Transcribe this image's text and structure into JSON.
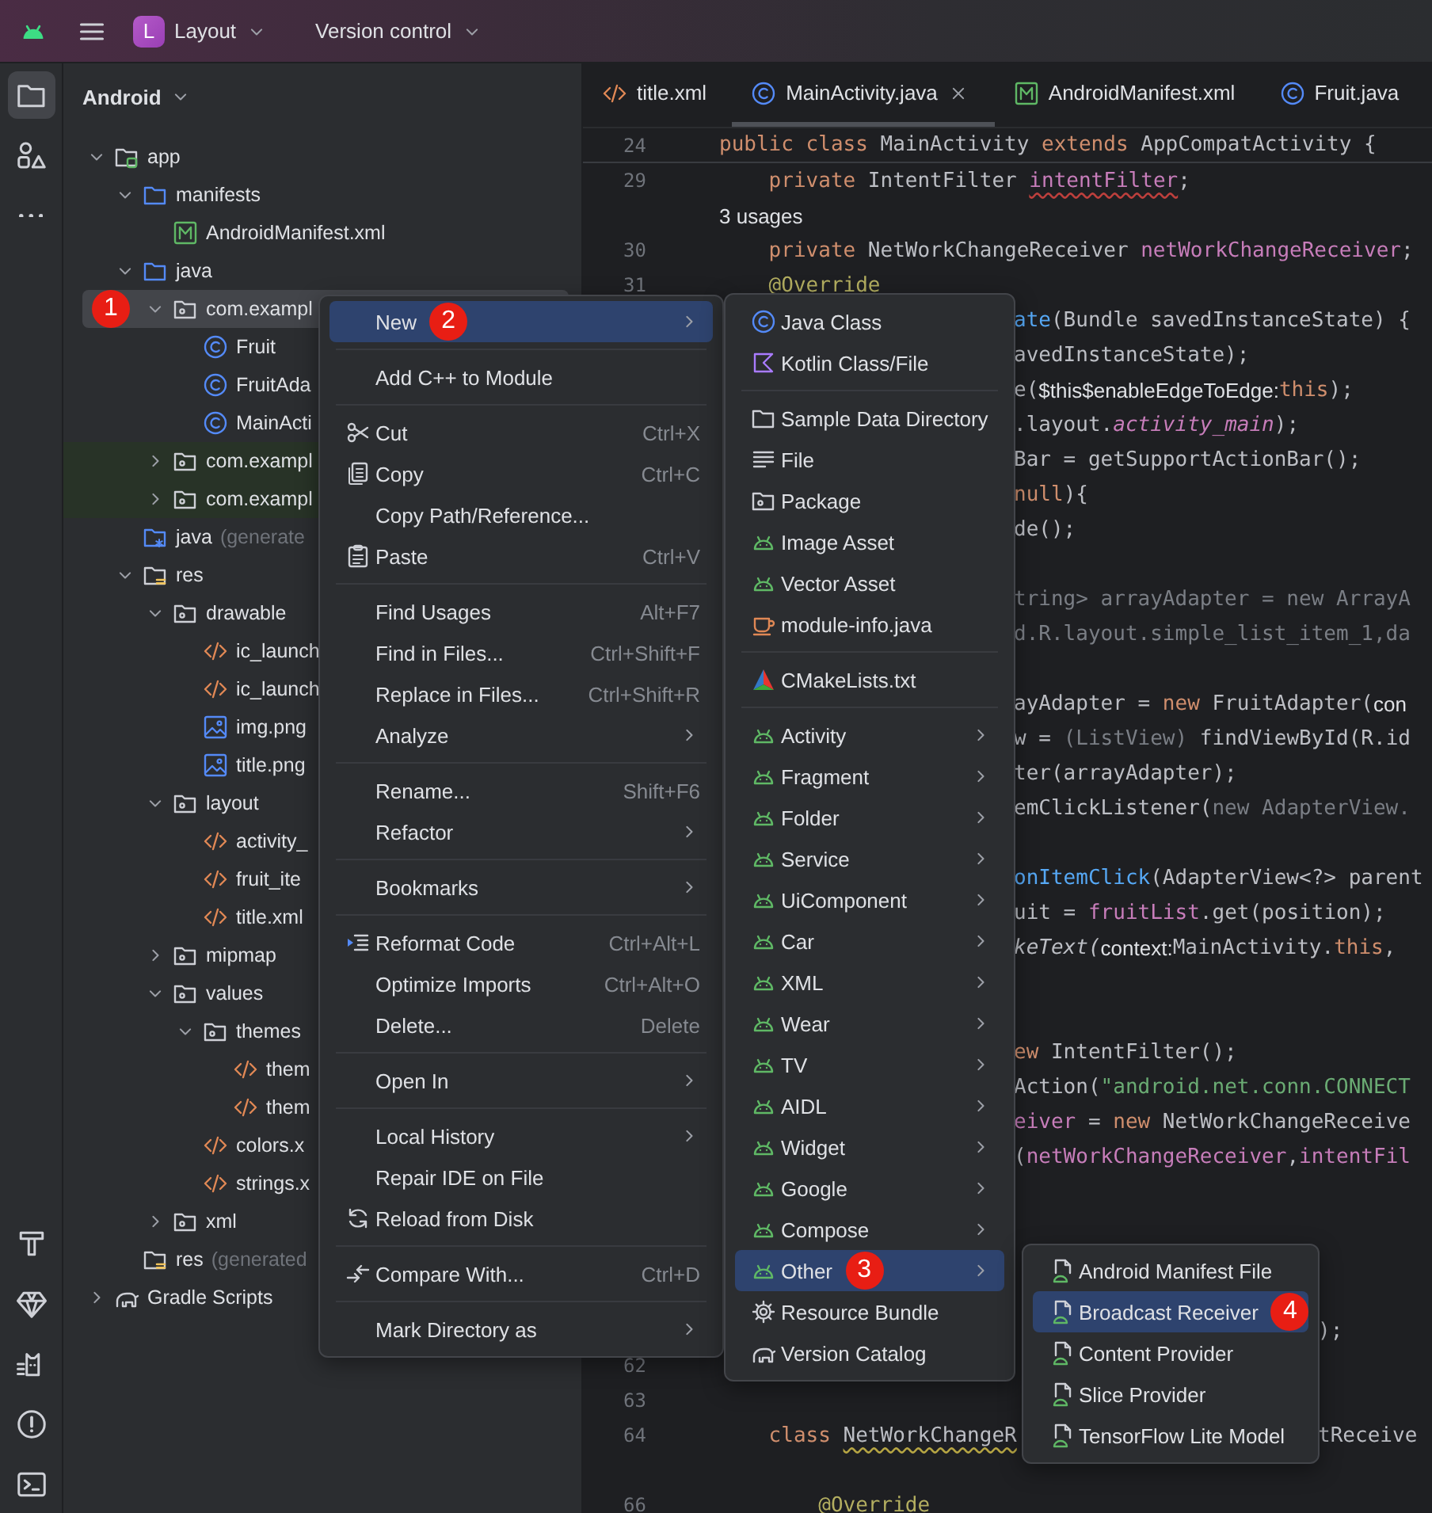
{
  "title_bar": {
    "project_badge": "L",
    "project_name": "Layout",
    "vcs_label": "Version control"
  },
  "toolbar_top": [
    {
      "kind": "folder",
      "selected": true
    },
    {
      "kind": "shapes",
      "selected": false
    },
    {
      "kind": "more",
      "selected": false
    }
  ],
  "toolbar_bottom": [
    {
      "kind": "hammer"
    },
    {
      "kind": "gem"
    },
    {
      "kind": "cat"
    },
    {
      "kind": "alert"
    },
    {
      "kind": "terminal"
    }
  ],
  "project_panel": {
    "view": "Android",
    "items": [
      {
        "label": "app",
        "kind": "module",
        "expanded": true,
        "selected": false,
        "children": [
          {
            "label": "manifests",
            "kind": "folder-blue",
            "expanded": true,
            "selected": false,
            "children": [
              {
                "label": "AndroidManifest.xml",
                "kind": "manifest",
                "selected": false
              }
            ]
          },
          {
            "label": "java",
            "kind": "folder-blue",
            "expanded": true,
            "selected": false,
            "children": [
              {
                "label": "com.exampl",
                "kind": "package",
                "expanded": true,
                "selected": true,
                "badge": "1",
                "children": [
                  {
                    "label": "Fruit",
                    "kind": "class",
                    "selected": false
                  },
                  {
                    "label": "FruitAda",
                    "kind": "class",
                    "selected": false
                  },
                  {
                    "label": "MainActi",
                    "kind": "class",
                    "selected": false
                  }
                ]
              },
              {
                "label": "com.exampl",
                "kind": "test-package",
                "expanded": false,
                "selected": false
              },
              {
                "label": "com.exampl",
                "kind": "test-package",
                "expanded": false,
                "selected": false
              }
            ]
          },
          {
            "label": "java",
            "note": "(generate",
            "kind": "java-gen",
            "selected": false
          },
          {
            "label": "res",
            "kind": "res",
            "expanded": true,
            "selected": false,
            "children": [
              {
                "label": "drawable",
                "kind": "package",
                "expanded": true,
                "selected": false,
                "children": [
                  {
                    "label": "ic_launch",
                    "kind": "xml",
                    "selected": false
                  },
                  {
                    "label": "ic_launch",
                    "kind": "xml",
                    "selected": false
                  },
                  {
                    "label": "img.png",
                    "kind": "image",
                    "selected": false
                  },
                  {
                    "label": "title.png",
                    "kind": "image",
                    "selected": false
                  }
                ]
              },
              {
                "label": "layout",
                "kind": "package",
                "expanded": true,
                "selected": false,
                "children": [
                  {
                    "label": "activity_",
                    "kind": "xml",
                    "selected": false
                  },
                  {
                    "label": "fruit_ite",
                    "kind": "xml",
                    "selected": false
                  },
                  {
                    "label": "title.xml",
                    "kind": "xml",
                    "selected": false
                  }
                ]
              },
              {
                "label": "mipmap",
                "kind": "package",
                "expanded": false,
                "selected": false
              },
              {
                "label": "values",
                "kind": "package",
                "expanded": true,
                "selected": false,
                "children": [
                  {
                    "label": "themes",
                    "kind": "package",
                    "expanded": true,
                    "selected": false,
                    "children": [
                      {
                        "label": "them",
                        "kind": "xml",
                        "selected": false
                      },
                      {
                        "label": "them",
                        "kind": "xml",
                        "selected": false
                      }
                    ]
                  },
                  {
                    "label": "colors.x",
                    "kind": "xml",
                    "selected": false
                  },
                  {
                    "label": "strings.x",
                    "kind": "xml",
                    "selected": false
                  }
                ]
              },
              {
                "label": "xml",
                "kind": "package",
                "expanded": false,
                "selected": false
              }
            ]
          },
          {
            "label": "res",
            "note": "(generated",
            "kind": "res",
            "selected": false
          }
        ]
      },
      {
        "label": "Gradle Scripts",
        "kind": "gradle",
        "expanded": false,
        "selected": false
      }
    ]
  },
  "editor": {
    "tabs": [
      {
        "label": "title.xml",
        "kind": "xml",
        "selected": false
      },
      {
        "label": "MainActivity.java",
        "kind": "class",
        "selected": true
      },
      {
        "label": "AndroidManifest.xml",
        "kind": "manifest",
        "selected": false
      },
      {
        "label": "Fruit.java",
        "kind": "class",
        "selected": false
      }
    ],
    "sticky_line": {
      "number": "24",
      "tokens": [
        {
          "text": "public class ",
          "kind": "keyword"
        },
        {
          "text": "MainActivity ",
          "kind": "plain"
        },
        {
          "text": "extends ",
          "kind": "keyword"
        },
        {
          "text": "AppCompatActivity {",
          "kind": "plain"
        }
      ]
    },
    "rows": [
      {
        "number": "29",
        "parts": [
          [
            {
              "text": "    private ",
              "kind": "keyword"
            },
            {
              "text": "IntentFilter ",
              "kind": "plain"
            },
            {
              "text": "intentFilter",
              "kind": "field-warning"
            },
            {
              "text": ";",
              "kind": "plain"
            }
          ]
        ]
      },
      {
        "parts": [
          [
            {
              "text": "3 usages",
              "kind": "usages"
            }
          ]
        ]
      },
      {
        "number": "30",
        "parts": [
          [
            {
              "text": "    private ",
              "kind": "keyword"
            },
            {
              "text": "NetWorkChangeReceiver ",
              "kind": "plain"
            },
            {
              "text": "netWorkChangeReceiver",
              "kind": "field"
            },
            {
              "text": ";",
              "kind": "plain"
            }
          ]
        ]
      },
      {
        "number": "31",
        "parts": [
          [
            {
              "text": "    @Override",
              "kind": "annotation"
            }
          ]
        ]
      },
      {
        "parts": [
          [
            {
              "text": "ate",
              "kind": "method"
            },
            {
              "text": "(Bundle savedInstanceState) {",
              "kind": "plain"
            }
          ]
        ]
      },
      {
        "parts": [
          [
            {
              "text": "avedInstanceState);",
              "kind": "plain"
            }
          ]
        ]
      },
      {
        "parts": [
          [
            {
              "text": "e(",
              "kind": "plain"
            },
            {
              "text": "$this$enableEdgeToEdge:",
              "kind": "hint"
            },
            {
              "text": "this",
              "kind": "keyword"
            },
            {
              "text": ");",
              "kind": "plain"
            }
          ]
        ]
      },
      {
        "parts": [
          [
            {
              "text": ".layout.",
              "kind": "plain"
            },
            {
              "text": "activity_main",
              "kind": "field-italic"
            },
            {
              "text": ");",
              "kind": "plain"
            }
          ]
        ]
      },
      {
        "parts": [
          [
            {
              "text": "Bar = getSupportActionBar();",
              "kind": "plain"
            }
          ]
        ]
      },
      {
        "parts": [
          [
            {
              "text": "null",
              "kind": "keyword"
            },
            {
              "text": "){",
              "kind": "plain"
            }
          ]
        ]
      },
      {
        "parts": [
          [
            {
              "text": "de();",
              "kind": "plain"
            }
          ]
        ]
      },
      {},
      {
        "parts": [
          [
            {
              "text": "tring> arrayAdapter = new ArrayA",
              "kind": "dim"
            }
          ]
        ]
      },
      {
        "parts": [
          [
            {
              "text": "d.R.layout.simple_list_item_1,da",
              "kind": "dim"
            }
          ]
        ]
      },
      {},
      {
        "parts": [
          [
            {
              "text": "ayAdapter = ",
              "kind": "plain"
            },
            {
              "text": "new",
              "kind": "keyword"
            },
            {
              "text": " FruitAdapter(",
              "kind": "plain"
            },
            {
              "text": "con",
              "kind": "hint"
            }
          ]
        ]
      },
      {
        "parts": [
          [
            {
              "text": "w = ",
              "kind": "plain"
            },
            {
              "text": "(ListView)",
              "kind": "dim"
            },
            {
              "text": " findViewById(R.id",
              "kind": "plain"
            }
          ]
        ]
      },
      {
        "parts": [
          [
            {
              "text": "ter(arrayAdapter);",
              "kind": "plain"
            }
          ]
        ]
      },
      {
        "parts": [
          [
            {
              "text": "emClickListener(",
              "kind": "plain"
            },
            {
              "text": "new AdapterView.",
              "kind": "dim"
            }
          ]
        ]
      },
      {},
      {
        "parts": [
          [
            {
              "text": "onItemClick",
              "kind": "method"
            },
            {
              "text": "(AdapterView<?> parent",
              "kind": "plain"
            }
          ]
        ]
      },
      {
        "parts": [
          [
            {
              "text": "uit = ",
              "kind": "plain"
            },
            {
              "text": "fruitList",
              "kind": "field"
            },
            {
              "text": ".get(position);",
              "kind": "plain"
            }
          ]
        ]
      },
      {
        "parts": [
          [
            {
              "text": "keText(",
              "kind": "italic"
            },
            {
              "text": "context:",
              "kind": "hint"
            },
            {
              "text": "MainActivity.",
              "kind": "plain"
            },
            {
              "text": "this",
              "kind": "keyword"
            },
            {
              "text": ",",
              "kind": "plain"
            }
          ]
        ]
      },
      {},
      {},
      {
        "parts": [
          [
            {
              "text": "ew",
              "kind": "keyword"
            },
            {
              "text": " IntentFilter();",
              "kind": "plain"
            }
          ]
        ]
      },
      {
        "parts": [
          [
            {
              "text": "Action(",
              "kind": "plain"
            },
            {
              "text": "\"android.net.conn.CONNECT",
              "kind": "string"
            }
          ]
        ]
      },
      {
        "parts": [
          [
            {
              "text": "eiver",
              "kind": "field"
            },
            {
              "text": " = ",
              "kind": "plain"
            },
            {
              "text": "new",
              "kind": "keyword"
            },
            {
              "text": " NetWorkChangeReceive",
              "kind": "plain"
            }
          ]
        ]
      },
      {
        "parts": [
          [
            {
              "text": "(",
              "kind": "plain"
            },
            {
              "text": "netWorkChangeReceiver",
              "kind": "field"
            },
            {
              "text": ",",
              "kind": "plain"
            },
            {
              "text": "intentFil",
              "kind": "field"
            }
          ]
        ]
      },
      {},
      {},
      {},
      {},
      {
        "parts": [
          [
            {
              "text": ");",
              "kind": "plain"
            }
          ]
        ]
      },
      {
        "number": "62"
      },
      {
        "number": "63"
      },
      {
        "number": "64",
        "parts": [
          [
            {
              "text": "    class ",
              "kind": "keyword"
            },
            {
              "text": "NetWorkChangeR",
              "kind": "warning"
            }
          ],
          [
            {
              "text": "tReceive",
              "kind": "plain"
            }
          ]
        ]
      },
      {},
      {
        "number": "66",
        "parts": [
          [
            {
              "text": "        @Override",
              "kind": "annotation"
            }
          ]
        ]
      }
    ]
  },
  "menus": [
    {
      "groups": [
        [
          {
            "label": "New",
            "selected": true,
            "submenu": true,
            "badge": "2"
          }
        ],
        [
          {
            "label": "Add C++ to Module",
            "selected": false
          }
        ],
        [
          {
            "label": "Cut",
            "kind": "scissors",
            "shortcut": "Ctrl+X",
            "selected": false
          },
          {
            "label": "Copy",
            "kind": "copy",
            "shortcut": "Ctrl+C",
            "selected": false
          },
          {
            "label": "Copy Path/Reference...",
            "selected": false
          },
          {
            "label": "Paste",
            "kind": "paste",
            "shortcut": "Ctrl+V",
            "selected": false
          }
        ],
        [
          {
            "label": "Find Usages",
            "shortcut": "Alt+F7",
            "selected": false
          },
          {
            "label": "Find in Files...",
            "shortcut": "Ctrl+Shift+F",
            "selected": false
          },
          {
            "label": "Replace in Files...",
            "shortcut": "Ctrl+Shift+R",
            "selected": false
          },
          {
            "label": "Analyze",
            "submenu": true,
            "selected": false
          }
        ],
        [
          {
            "label": "Rename...",
            "shortcut": "Shift+F6",
            "selected": false
          },
          {
            "label": "Refactor",
            "submenu": true,
            "selected": false
          }
        ],
        [
          {
            "label": "Bookmarks",
            "submenu": true,
            "selected": false
          }
        ],
        [
          {
            "label": "Reformat Code",
            "kind": "reformat",
            "shortcut": "Ctrl+Alt+L",
            "selected": false
          },
          {
            "label": "Optimize Imports",
            "shortcut": "Ctrl+Alt+O",
            "selected": false
          },
          {
            "label": "Delete...",
            "shortcut": "Delete",
            "selected": false
          }
        ],
        [
          {
            "label": "Open In",
            "submenu": true,
            "selected": false
          }
        ],
        [
          {
            "label": "Local History",
            "submenu": true,
            "selected": false
          },
          {
            "label": "Repair IDE on File",
            "selected": false
          },
          {
            "label": "Reload from Disk",
            "kind": "reload",
            "selected": false
          }
        ],
        [
          {
            "label": "Compare With...",
            "kind": "compare",
            "shortcut": "Ctrl+D",
            "selected": false
          }
        ],
        [
          {
            "label": "Mark Directory as",
            "submenu": true,
            "selected": false
          }
        ]
      ]
    },
    {
      "groups": [
        [
          {
            "label": "Java Class",
            "kind": "class",
            "selected": false
          },
          {
            "label": "Kotlin Class/File",
            "kind": "kotlin",
            "selected": false
          }
        ],
        [
          {
            "label": "Sample Data Directory",
            "kind": "folder",
            "selected": false
          },
          {
            "label": "File",
            "kind": "lines",
            "selected": false
          },
          {
            "label": "Package",
            "kind": "package",
            "selected": false
          },
          {
            "label": "Image Asset",
            "kind": "android",
            "selected": false
          },
          {
            "label": "Vector Asset",
            "kind": "android",
            "selected": false
          },
          {
            "label": "module-info.java",
            "kind": "cup",
            "selected": false
          }
        ],
        [
          {
            "label": "CMakeLists.txt",
            "kind": "cmake",
            "selected": false
          }
        ],
        [
          {
            "label": "Activity",
            "kind": "android",
            "submenu": true,
            "selected": false
          },
          {
            "label": "Fragment",
            "kind": "android",
            "submenu": true,
            "selected": false
          },
          {
            "label": "Folder",
            "kind": "android",
            "submenu": true,
            "selected": false
          },
          {
            "label": "Service",
            "kind": "android",
            "submenu": true,
            "selected": false
          },
          {
            "label": "UiComponent",
            "kind": "android",
            "submenu": true,
            "selected": false
          },
          {
            "label": "Car",
            "kind": "android",
            "submenu": true,
            "selected": false
          },
          {
            "label": "XML",
            "kind": "android",
            "submenu": true,
            "selected": false
          },
          {
            "label": "Wear",
            "kind": "android",
            "submenu": true,
            "selected": false
          },
          {
            "label": "TV",
            "kind": "android",
            "submenu": true,
            "selected": false
          },
          {
            "label": "AIDL",
            "kind": "android",
            "submenu": true,
            "selected": false
          },
          {
            "label": "Widget",
            "kind": "android",
            "submenu": true,
            "selected": false
          },
          {
            "label": "Google",
            "kind": "android",
            "submenu": true,
            "selected": false
          },
          {
            "label": "Compose",
            "kind": "android",
            "submenu": true,
            "selected": false
          },
          {
            "label": "Other",
            "kind": "android",
            "submenu": true,
            "selected": true,
            "badge": "3"
          },
          {
            "label": "Resource Bundle",
            "kind": "gear",
            "selected": false
          },
          {
            "label": "Version Catalog",
            "kind": "gradle",
            "selected": false
          }
        ]
      ]
    },
    {
      "groups": [
        [
          {
            "label": "Android Manifest File",
            "kind": "android-file",
            "selected": false
          },
          {
            "label": "Broadcast Receiver",
            "kind": "android-file",
            "selected": true,
            "badge": "4"
          },
          {
            "label": "Content Provider",
            "kind": "android-file",
            "selected": false
          },
          {
            "label": "Slice Provider",
            "kind": "android-file",
            "selected": false
          },
          {
            "label": "TensorFlow Lite Model",
            "kind": "android-file",
            "selected": false
          }
        ]
      ]
    }
  ]
}
